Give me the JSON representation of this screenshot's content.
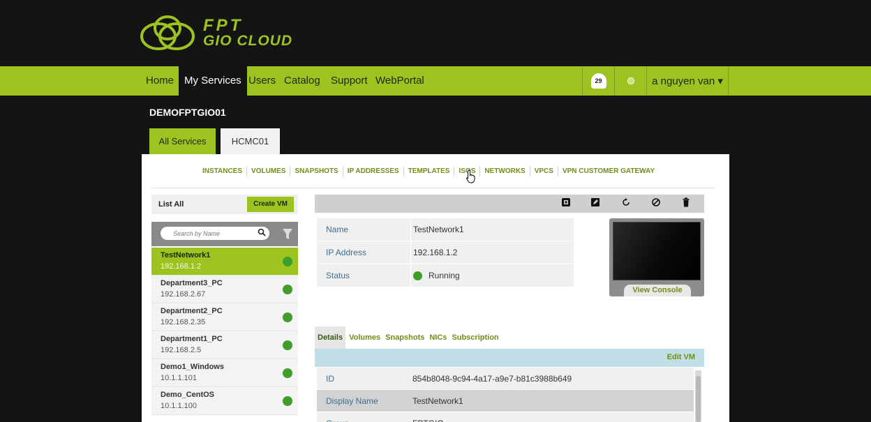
{
  "brand": {
    "line1": "FPT",
    "line2": "GIO CLOUD"
  },
  "nav": {
    "items": [
      "Home",
      "My Services",
      "Users",
      "Catalog",
      "Support",
      "WebPortal"
    ],
    "active": "My Services",
    "notification_count": "29",
    "user": "a nguyen van ▾"
  },
  "account": "DEMOFPTGIO01",
  "tabs": [
    "All Services",
    "HCMC01"
  ],
  "subnav": [
    "INSTANCES",
    "VOLUMES",
    "SNAPSHOTS",
    "IP ADDRESSES",
    "TEMPLATES",
    "ISOS",
    "NETWORKS",
    "VPCS",
    "VPN CUSTOMER GATEWAY"
  ],
  "list": {
    "title": "List All",
    "create_label": "Create VM",
    "search_placeholder": "Search by Name",
    "items": [
      {
        "name": "TestNetwork1",
        "ip": "192.168.1.2",
        "status": "running"
      },
      {
        "name": "Department3_PC",
        "ip": "192.168.2.67",
        "status": "running"
      },
      {
        "name": "Department2_PC",
        "ip": "192.168.2.35",
        "status": "running"
      },
      {
        "name": "Department1_PC",
        "ip": "192.168.2.5",
        "status": "running"
      },
      {
        "name": "Demo1_Windows",
        "ip": "10.1.1.101",
        "status": "running"
      },
      {
        "name": "Demo_CentOS",
        "ip": "10.1.1.100",
        "status": "running"
      }
    ]
  },
  "summary": {
    "rows": [
      {
        "key": "Name",
        "value": "TestNetwork1"
      },
      {
        "key": "IP Address",
        "value": "192.168.1.2"
      },
      {
        "key": "Status",
        "value": "Running"
      }
    ]
  },
  "console": {
    "label": "View Console"
  },
  "detail_tabs": [
    "Details",
    "Volumes",
    "Snapshots",
    "NICs",
    "Subscription"
  ],
  "edit_label": "Edit VM",
  "details": [
    {
      "key": "ID",
      "value": "854b8048-9c94-4a17-a9e7-b81c3988b649"
    },
    {
      "key": "Display Name",
      "value": "TestNetwork1"
    },
    {
      "key": "Group",
      "value": "FPTGIO"
    }
  ],
  "colors": {
    "accent": "#9cc320",
    "running": "#3f9e2b",
    "dark": "#141414"
  }
}
